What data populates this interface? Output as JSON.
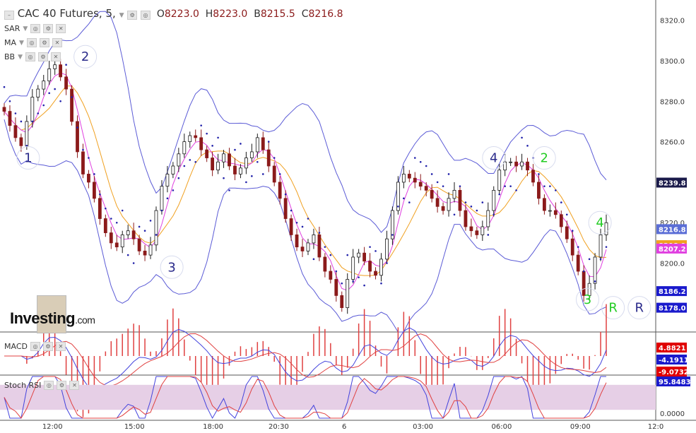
{
  "header": {
    "symbol": "CAC 40 Futures, 5,",
    "open_key": "O",
    "open": "8223.0",
    "high_key": "H",
    "high": "8223.0",
    "low_key": "B",
    "low": "8215.5",
    "close_key": "C",
    "close": "8216.8"
  },
  "indicators": {
    "sar": "SAR",
    "ma": "MA",
    "bb": "BB",
    "macd": "MACD",
    "stoch": "Stoch RSI"
  },
  "logo": {
    "text": "Investing",
    "suffix": ".com"
  },
  "icons": [
    "settings-icon",
    "eye-icon",
    "close-icon",
    "chevron-down-icon"
  ],
  "colors": {
    "up": "#1a1a1a",
    "down": "#8b1a1a",
    "bb": "#5b5bd6",
    "ma_fast": "#e040e0",
    "ma_slow": "#f0a020",
    "sar": "#2222aa",
    "macd": "#4444dd",
    "signal": "#e04040",
    "hist": "#e04040",
    "stoch_k": "#4444dd",
    "stoch_d": "#e04040",
    "wave_blue": "#2a2a8a",
    "wave_green": "#22cc22"
  },
  "chart_data": {
    "type": "line",
    "title": "CAC 40 Futures, 5,",
    "main": {
      "ylim": [
        8166,
        8330
      ],
      "y_ticks": [
        "8320.0",
        "8300.0",
        "8280.0",
        "8260.0",
        "8240.0",
        "8220.0",
        "8200.0"
      ],
      "price_labels": [
        {
          "value": "8239.8",
          "color": "#1a1a4a"
        },
        {
          "value": "8216.8",
          "color": "#5b6ed6"
        },
        {
          "value": "8208.9",
          "color": "#f0a020"
        },
        {
          "value": "8207.2",
          "color": "#e040e0"
        },
        {
          "value": "8186.2",
          "color": "#1a1acc"
        },
        {
          "value": "8178.0",
          "color": "#1a1acc"
        }
      ],
      "close_series": [
        8275,
        8268,
        8262,
        8258,
        8270,
        8282,
        8286,
        8290,
        8296,
        8298,
        8292,
        8286,
        8270,
        8255,
        8244,
        8240,
        8232,
        8222,
        8215,
        8210,
        8208,
        8214,
        8216,
        8212,
        8206,
        8204,
        8209,
        8226,
        8238,
        8244,
        8248,
        8254,
        8260,
        8263,
        8262,
        8256,
        8252,
        8246,
        8250,
        8254,
        8248,
        8244,
        8247,
        8252,
        8255,
        8262,
        8256,
        8248,
        8240,
        8232,
        8222,
        8214,
        8208,
        8206,
        8210,
        8214,
        8203,
        8196,
        8192,
        8184,
        8178,
        8192,
        8203,
        8205,
        8201,
        8196,
        8194,
        8202,
        8212,
        8226,
        8240,
        8244,
        8242,
        8240,
        8238,
        8236,
        8232,
        8228,
        8226,
        8232,
        8236,
        8226,
        8218,
        8216,
        8214,
        8218,
        8226,
        8236,
        8246,
        8250,
        8250,
        8248,
        8250,
        8246,
        8240,
        8232,
        8226,
        8226,
        8224,
        8218,
        8212,
        8204,
        8196,
        8184,
        8190,
        8203,
        8214,
        8220
      ]
    },
    "wave_labels": [
      {
        "label": "1",
        "x": 0.043,
        "value": 8252,
        "color": "#2a2a8a"
      },
      {
        "label": "2",
        "x": 0.13,
        "value": 8302,
        "color": "#2a2a8a"
      },
      {
        "label": "3",
        "x": 0.262,
        "value": 8198,
        "color": "#2a2a8a"
      },
      {
        "label": "4",
        "x": 0.753,
        "value": 8252,
        "color": "#2a2a8a"
      },
      {
        "label": "2",
        "x": 0.83,
        "value": 8252,
        "color": "#22cc22"
      },
      {
        "label": "4",
        "x": 0.915,
        "value": 8220,
        "color": "#22cc22"
      },
      {
        "label": "3",
        "x": 0.896,
        "value": 8182,
        "color": "#22cc22"
      },
      {
        "label": "R",
        "x": 0.935,
        "value": 8178,
        "color": "#22cc22"
      },
      {
        "label": "R",
        "x": 0.975,
        "value": 8178,
        "color": "#2a2a8a"
      }
    ],
    "xaxis": {
      "ticks": [
        "12:00",
        "15:00",
        "18:00",
        "20:30",
        "6",
        "03:00",
        "06:00",
        "09:00",
        "12:0"
      ],
      "tick_fracs": [
        0.08,
        0.205,
        0.325,
        0.425,
        0.525,
        0.645,
        0.765,
        0.885,
        1.0
      ]
    },
    "macd": {
      "labels": [
        "4.8821",
        "-4.1911",
        "-9.0732"
      ],
      "label_colors": [
        "#e00000",
        "#1a1acc",
        "#e00000"
      ]
    },
    "stoch": {
      "labels": [
        "95.8483",
        "0.0000"
      ],
      "band": [
        20,
        80
      ]
    }
  }
}
